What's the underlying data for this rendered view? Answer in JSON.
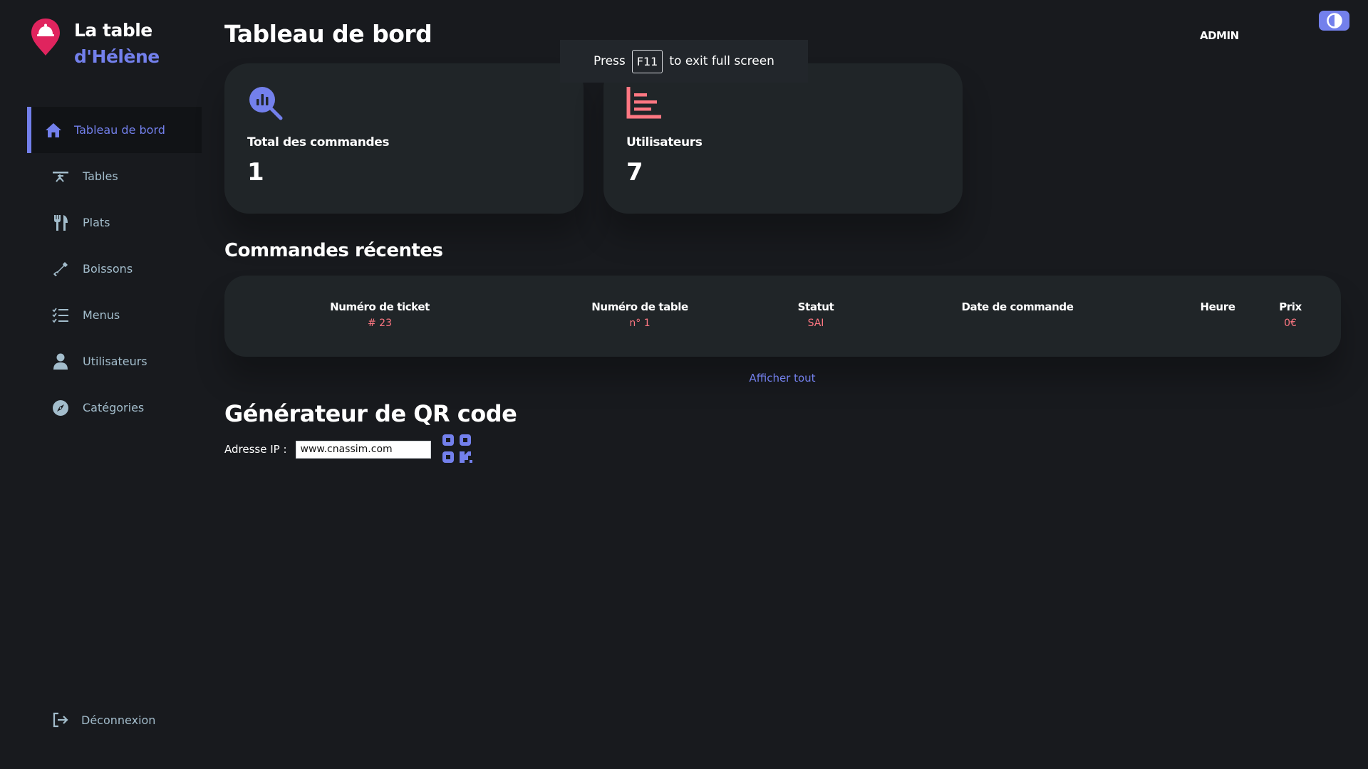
{
  "brand": {
    "line1": "La table",
    "line2": "d'Hélène"
  },
  "sidebar": {
    "items": [
      {
        "label": "Tableau de bord",
        "icon": "home-icon",
        "active": true
      },
      {
        "label": "Tables",
        "icon": "table-icon"
      },
      {
        "label": "Plats",
        "icon": "cutlery-icon"
      },
      {
        "label": "Boissons",
        "icon": "bottle-icon"
      },
      {
        "label": "Menus",
        "icon": "checklist-icon"
      },
      {
        "label": "Utilisateurs",
        "icon": "user-icon"
      },
      {
        "label": "Catégories",
        "icon": "compass-icon"
      }
    ],
    "logout": "Déconnexion"
  },
  "header": {
    "title": "Tableau de bord",
    "role": "ADMIN"
  },
  "toast": {
    "pre": "Press",
    "key": "F11",
    "post": "to exit full screen"
  },
  "cards": [
    {
      "label": "Total des commandes",
      "value": "1",
      "icon": "analytics-search-icon",
      "color": "#7380ec"
    },
    {
      "label": "Utilisateurs",
      "value": "7",
      "icon": "bar-chart-icon",
      "color": "#ff7782"
    }
  ],
  "orders": {
    "title": "Commandes récentes",
    "columns": [
      "Numéro de ticket",
      "Numéro de table",
      "Statut",
      "Date de commande",
      "Heure",
      "Prix"
    ],
    "row": [
      "# 23",
      "n° 1",
      "SAI",
      "",
      "",
      "0€"
    ],
    "show_all": "Afficher tout"
  },
  "qr": {
    "title": "Générateur de QR code",
    "label": "Adresse IP :",
    "value": "www.cnassim.com"
  },
  "colors": {
    "primary": "#7380ec",
    "danger": "#ff7782",
    "background": "#181a1e",
    "card": "#202528"
  }
}
